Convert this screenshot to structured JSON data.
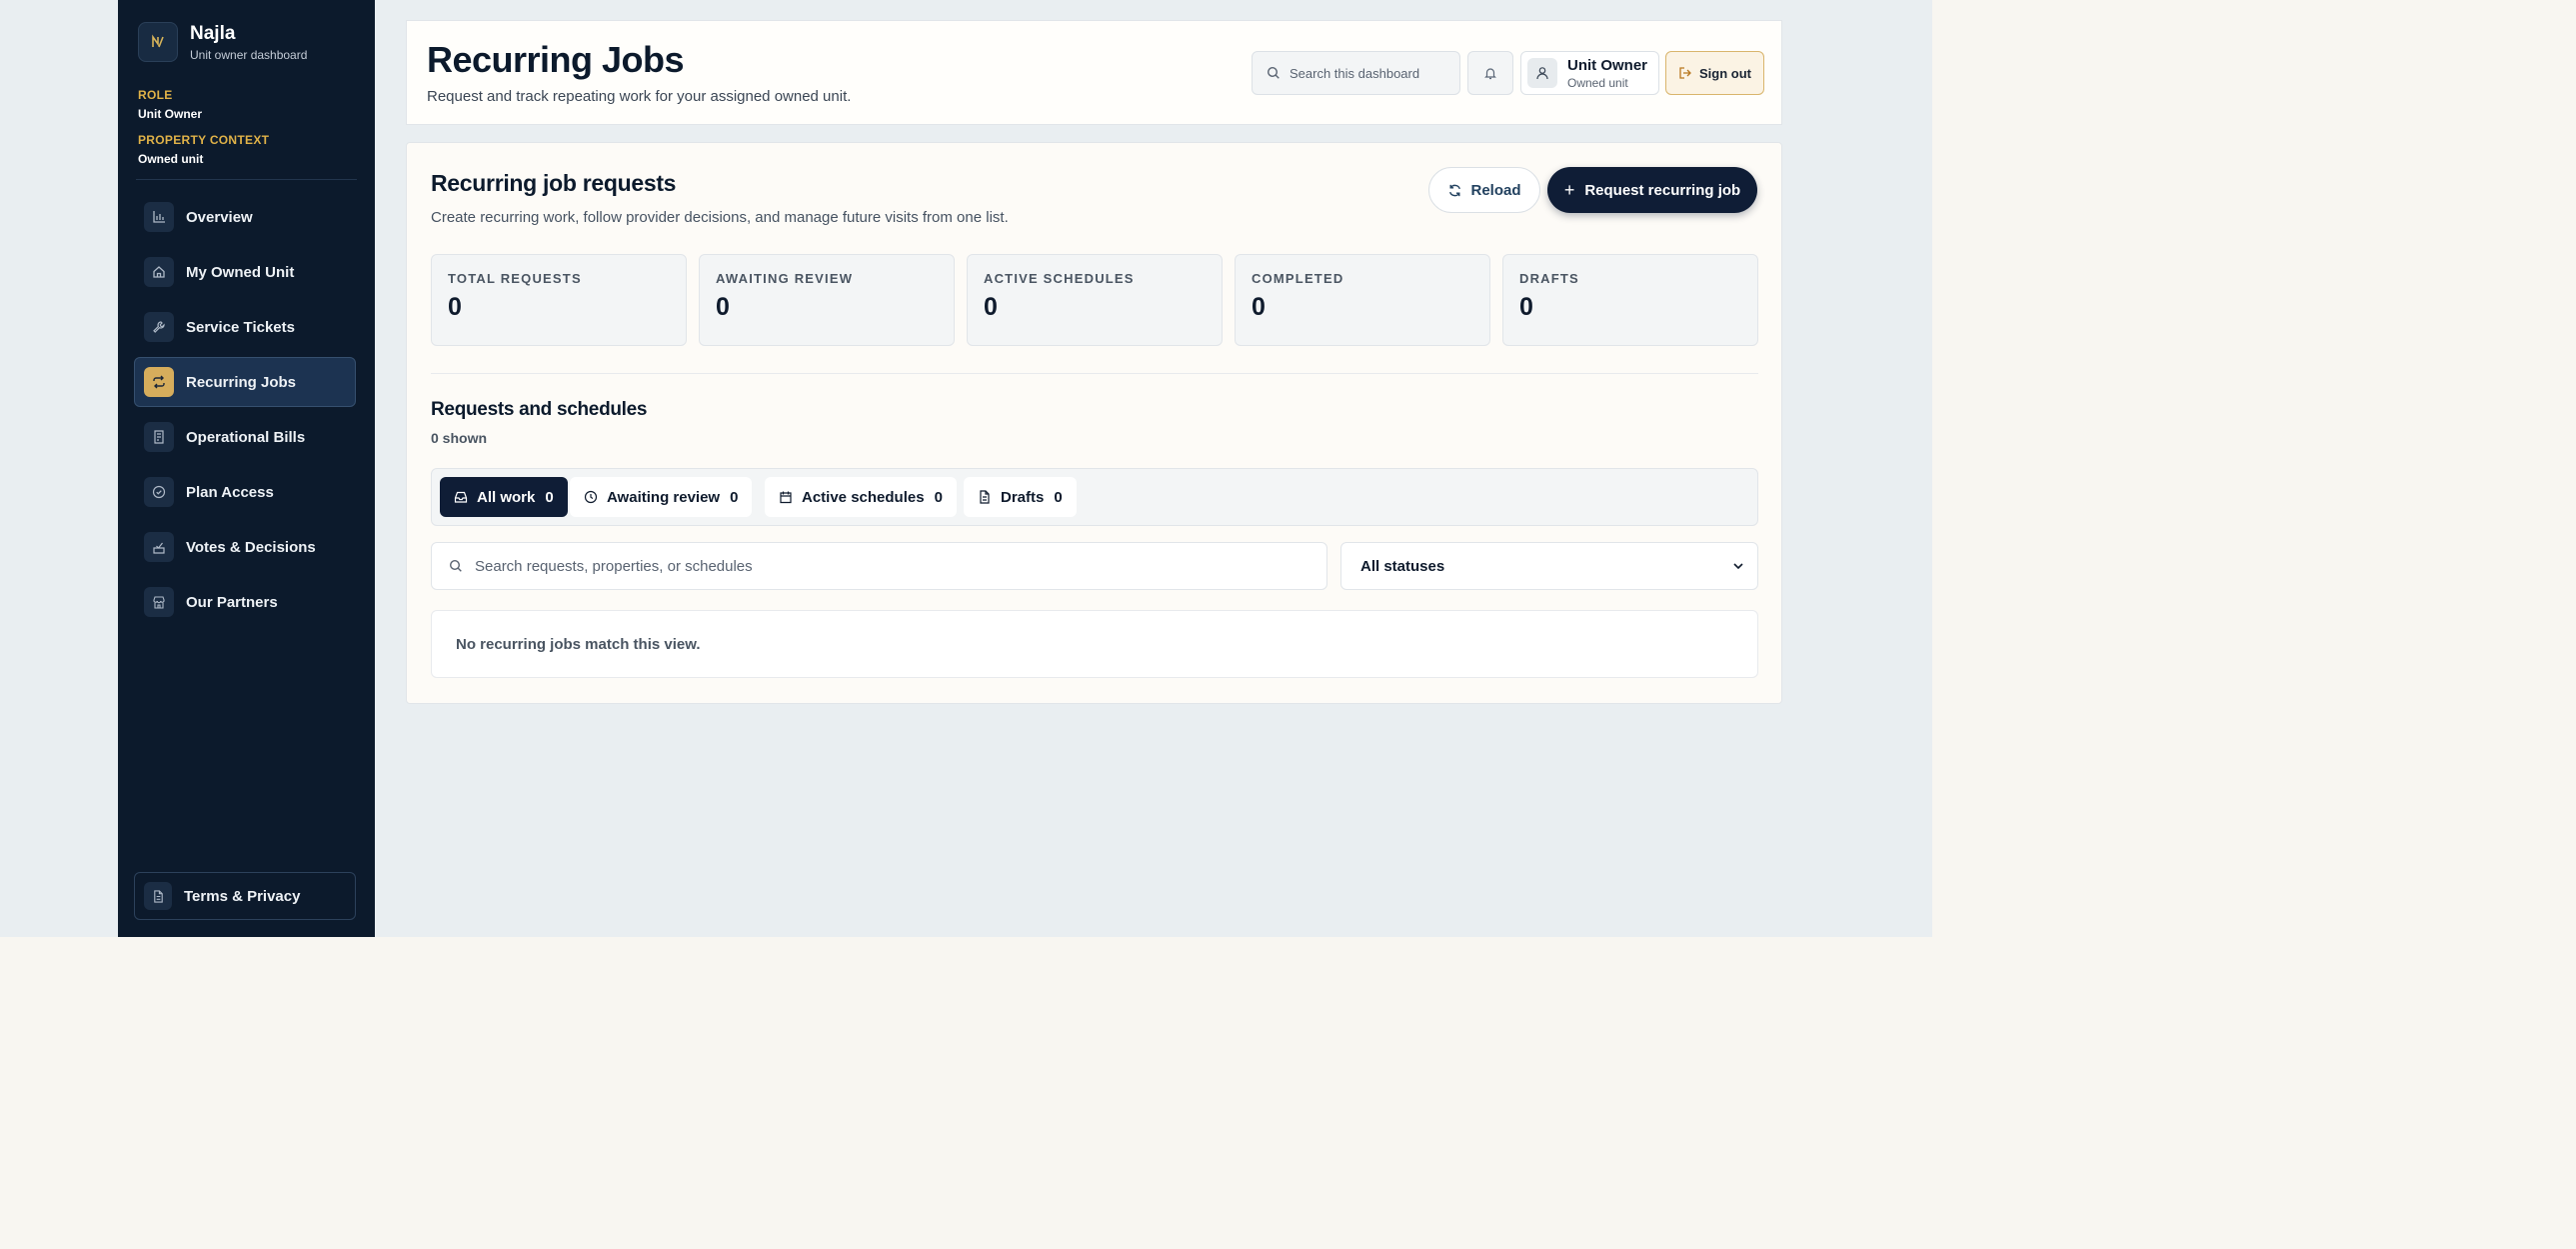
{
  "brand": {
    "name": "Najla",
    "subtitle": "Unit owner dashboard",
    "logo_text": "N"
  },
  "context": {
    "role_label": "ROLE",
    "role_value": "Unit Owner",
    "property_label": "PROPERTY CONTEXT",
    "property_value": "Owned unit"
  },
  "sidebar": {
    "items": [
      {
        "label": "Overview",
        "icon": "chart-icon"
      },
      {
        "label": "My Owned Unit",
        "icon": "home-icon"
      },
      {
        "label": "Service Tickets",
        "icon": "wrench-icon"
      },
      {
        "label": "Recurring Jobs",
        "icon": "repeat-icon",
        "active": true
      },
      {
        "label": "Operational Bills",
        "icon": "receipt-icon"
      },
      {
        "label": "Plan Access",
        "icon": "check-circle-icon"
      },
      {
        "label": "Votes & Decisions",
        "icon": "vote-icon"
      },
      {
        "label": "Our Partners",
        "icon": "store-icon"
      }
    ],
    "footer_label": "Terms & Privacy"
  },
  "header": {
    "title": "Recurring Jobs",
    "subtitle": "Request and track repeating work for your assigned owned unit.",
    "search_placeholder": "Search this dashboard",
    "user_name": "Unit Owner",
    "user_role": "Owned unit",
    "signout_label": "Sign out"
  },
  "panel": {
    "title": "Recurring job requests",
    "subtitle": "Create recurring work, follow provider decisions, and manage future visits from one list.",
    "reload_label": "Reload",
    "request_label": "Request recurring job",
    "stats": [
      {
        "label": "TOTAL REQUESTS",
        "value": "0"
      },
      {
        "label": "AWAITING REVIEW",
        "value": "0"
      },
      {
        "label": "ACTIVE SCHEDULES",
        "value": "0"
      },
      {
        "label": "COMPLETED",
        "value": "0"
      },
      {
        "label": "DRAFTS",
        "value": "0"
      }
    ]
  },
  "list": {
    "title": "Requests and schedules",
    "count": "0 shown",
    "tabs": [
      {
        "label": "All work",
        "count": "0"
      },
      {
        "label": "Awaiting review",
        "count": "0"
      },
      {
        "label": "Active schedules",
        "count": "0"
      },
      {
        "label": "Drafts",
        "count": "0"
      }
    ],
    "search_placeholder": "Search requests, properties, or schedules",
    "status_value": "All statuses",
    "empty_text": "No recurring jobs match this view."
  },
  "colors": {
    "sidebar_bg": "#0c1a2c",
    "accent": "#d6ad5c",
    "primary": "#0f1d36",
    "page_bg": "#e9eef1"
  }
}
